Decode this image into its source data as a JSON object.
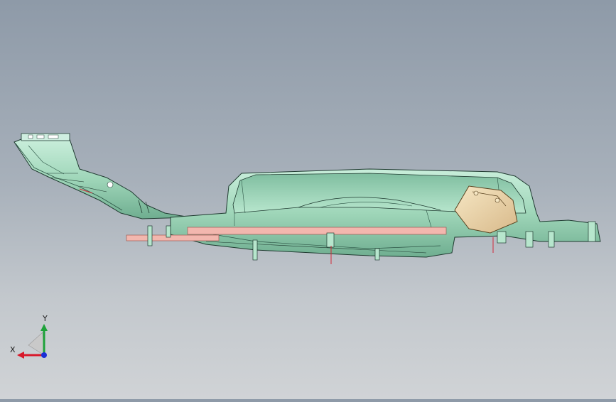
{
  "viewport": {
    "background_top": "#8e9aa8",
    "background_bottom": "#d0d3d6"
  },
  "model": {
    "body_color": "#a7dcc0",
    "edge_color": "#1f3a30",
    "plate_color": "#f2b7ae",
    "bracket_color": "#f3deb4",
    "pin_color": "#d22a3a"
  },
  "triad": {
    "x_label": "X",
    "y_label": "Y",
    "x_color": "#d8182a",
    "y_color": "#1ea23a",
    "z_color": "#1b2fd6"
  }
}
